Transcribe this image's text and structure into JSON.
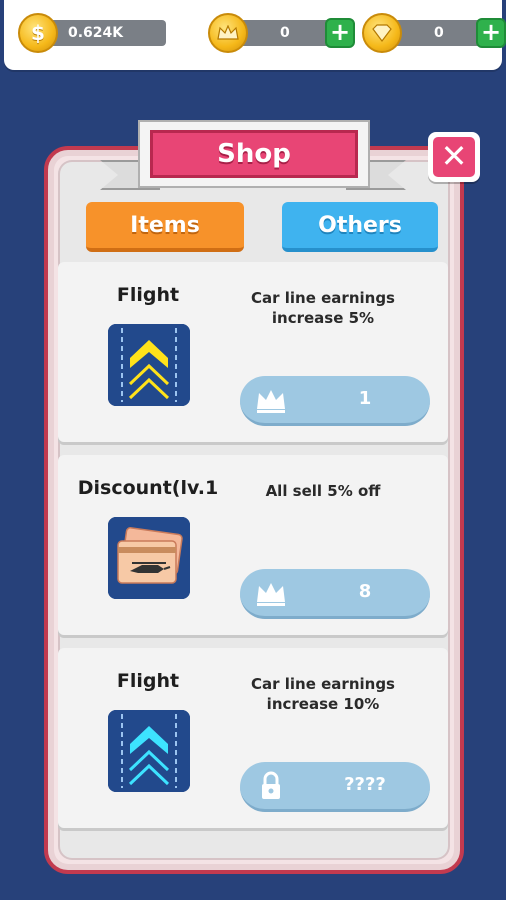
{
  "hud": {
    "coins": {
      "icon": "dollar-coin-icon",
      "value": "0.624K",
      "glyph": "$"
    },
    "crowns": {
      "icon": "crown-coin-icon",
      "value": "0",
      "add_icon": "plus-icon"
    },
    "gems": {
      "icon": "diamond-coin-icon",
      "value": "0",
      "add_icon": "plus-icon"
    }
  },
  "shop": {
    "title": "Shop",
    "close_icon": "close-icon",
    "tabs": [
      {
        "label": "Items",
        "color": "#f7922a"
      },
      {
        "label": "Others",
        "color": "#3fb3ef"
      }
    ],
    "items": [
      {
        "name": "Flight",
        "icon": "yellow-chevron-road-icon",
        "desc_line1": "Car line earnings",
        "desc_line2": "increase 5%",
        "price": "1",
        "price_icon": "crown-icon"
      },
      {
        "name": "Discount(lv.1",
        "icon": "helicopter-cards-icon",
        "desc_line1": "All sell 5% off",
        "desc_line2": "",
        "price": "8",
        "price_icon": "crown-icon"
      },
      {
        "name": "Flight",
        "icon": "cyan-chevron-road-icon",
        "desc_line1": "Car line earnings",
        "desc_line2": "increase 10%",
        "price": "????",
        "price_icon": "lock-icon"
      }
    ]
  },
  "colors": {
    "background": "#27417a",
    "accent_pink": "#e84575",
    "panel_border": "#c23a4f",
    "price_button": "#9ec8e2"
  }
}
